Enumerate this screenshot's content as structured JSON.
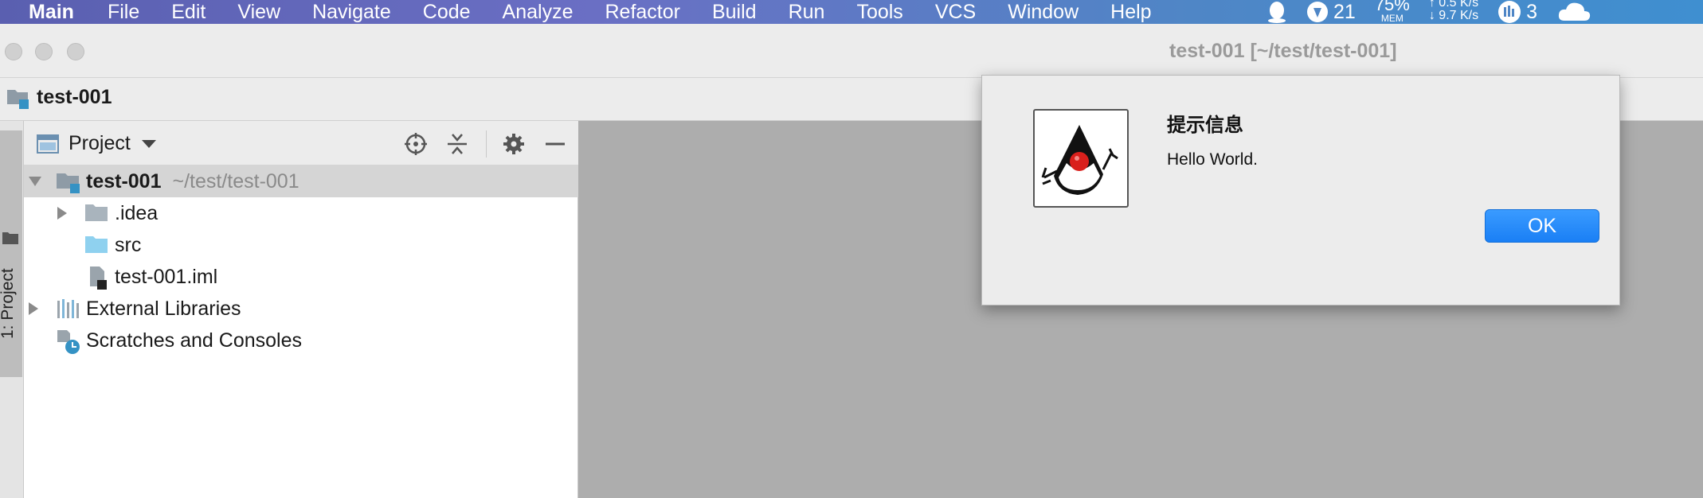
{
  "menubar": {
    "app_name": "Main",
    "items": [
      "File",
      "Edit",
      "View",
      "Navigate",
      "Code",
      "Analyze",
      "Refactor",
      "Build",
      "Run",
      "Tools",
      "VCS",
      "Window",
      "Help"
    ],
    "status": {
      "badge_count": "21",
      "mem_percent": "75%",
      "mem_label": "MEM",
      "net_up": "↑ 0.5 K/s",
      "net_down": "↓ 9.7 K/s",
      "extra_count": "3"
    }
  },
  "window": {
    "title": "test-001 [~/test/test-001]"
  },
  "navbar": {
    "breadcrumb": "test-001"
  },
  "toolstrip": {
    "tab_label": "1: Project"
  },
  "project_panel": {
    "title": "Project",
    "tree": {
      "root_name": "test-001",
      "root_path": "~/test/test-001",
      "idea": ".idea",
      "src": "src",
      "iml": "test-001.iml",
      "external": "External Libraries",
      "scratches": "Scratches and Consoles"
    }
  },
  "dialog": {
    "title": "提示信息",
    "message": "Hello World.",
    "ok_label": "OK"
  },
  "colors": {
    "accent": "#1a7ff5",
    "menubar_left": "#5a5fb0",
    "menubar_right": "#3f8fd0",
    "editor_bg": "#adadad"
  }
}
